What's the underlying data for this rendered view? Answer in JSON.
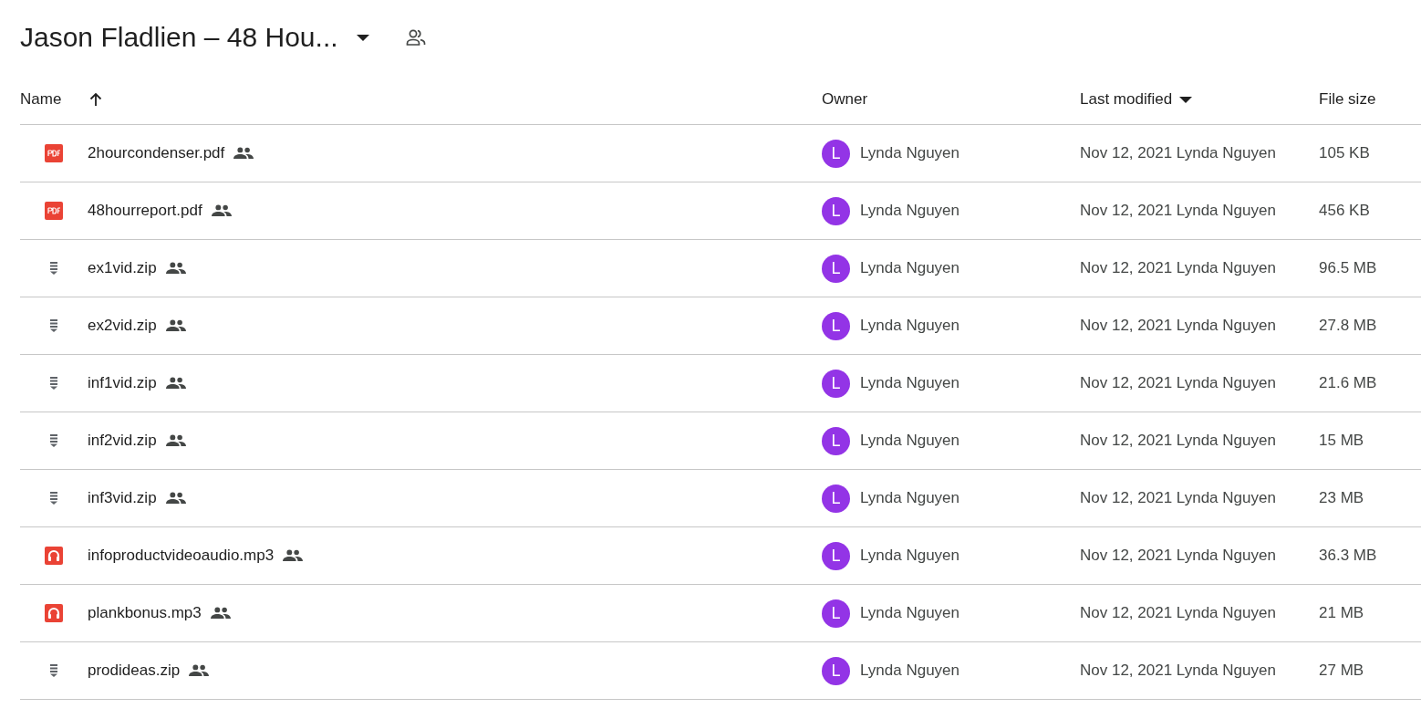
{
  "folder": {
    "title": "Jason Fladlien – 48 Hou...",
    "shared": true
  },
  "table": {
    "columns": [
      {
        "label": "Name",
        "sorted_ascending": true,
        "has_menu": false
      },
      {
        "label": "Owner",
        "sorted_ascending": false,
        "has_menu": false
      },
      {
        "label": "Last modified",
        "sorted_ascending": false,
        "has_menu": true
      },
      {
        "label": "File size",
        "sorted_ascending": false,
        "has_menu": false
      }
    ],
    "rows": [
      {
        "kind": "pdf",
        "name": "2hourcondenser.pdf",
        "shared": true,
        "owner_initial": "L",
        "owner": "Lynda Nguyen",
        "modified": "Nov 12, 2021 Lynda Nguyen",
        "size": "105 KB"
      },
      {
        "kind": "pdf",
        "name": "48hourreport.pdf",
        "shared": true,
        "owner_initial": "L",
        "owner": "Lynda Nguyen",
        "modified": "Nov 12, 2021 Lynda Nguyen",
        "size": "456 KB"
      },
      {
        "kind": "zip",
        "name": "ex1vid.zip",
        "shared": true,
        "owner_initial": "L",
        "owner": "Lynda Nguyen",
        "modified": "Nov 12, 2021 Lynda Nguyen",
        "size": "96.5 MB"
      },
      {
        "kind": "zip",
        "name": "ex2vid.zip",
        "shared": true,
        "owner_initial": "L",
        "owner": "Lynda Nguyen",
        "modified": "Nov 12, 2021 Lynda Nguyen",
        "size": "27.8 MB"
      },
      {
        "kind": "zip",
        "name": "inf1vid.zip",
        "shared": true,
        "owner_initial": "L",
        "owner": "Lynda Nguyen",
        "modified": "Nov 12, 2021 Lynda Nguyen",
        "size": "21.6 MB"
      },
      {
        "kind": "zip",
        "name": "inf2vid.zip",
        "shared": true,
        "owner_initial": "L",
        "owner": "Lynda Nguyen",
        "modified": "Nov 12, 2021 Lynda Nguyen",
        "size": "15 MB"
      },
      {
        "kind": "zip",
        "name": "inf3vid.zip",
        "shared": true,
        "owner_initial": "L",
        "owner": "Lynda Nguyen",
        "modified": "Nov 12, 2021 Lynda Nguyen",
        "size": "23 MB"
      },
      {
        "kind": "audio",
        "name": "infoproductvideoaudio.mp3",
        "shared": true,
        "owner_initial": "L",
        "owner": "Lynda Nguyen",
        "modified": "Nov 12, 2021 Lynda Nguyen",
        "size": "36.3 MB"
      },
      {
        "kind": "audio",
        "name": "plankbonus.mp3",
        "shared": true,
        "owner_initial": "L",
        "owner": "Lynda Nguyen",
        "modified": "Nov 12, 2021 Lynda Nguyen",
        "size": "21 MB"
      },
      {
        "kind": "zip",
        "name": "prodideas.zip",
        "shared": true,
        "owner_initial": "L",
        "owner": "Lynda Nguyen",
        "modified": "Nov 12, 2021 Lynda Nguyen",
        "size": "27 MB"
      }
    ]
  }
}
